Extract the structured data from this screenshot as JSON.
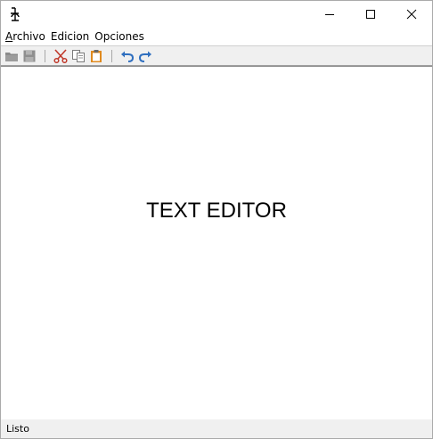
{
  "window": {
    "icon": "curly-glyph-icon",
    "controls": [
      "minimize-icon",
      "maximize-icon",
      "close-icon"
    ]
  },
  "menubar": {
    "items": [
      {
        "label_accel": "A",
        "label_rest": "rchivo"
      },
      {
        "label_accel": "",
        "label_rest": "Edicion"
      },
      {
        "label_accel": "",
        "label_rest": "Opciones"
      }
    ]
  },
  "toolbar": {
    "buttons": [
      "open-folder-icon",
      "save-disk-icon",
      "cut-scissors-icon",
      "copy-icon",
      "paste-clipboard-icon",
      "undo-icon",
      "redo-icon"
    ]
  },
  "editor": {
    "text": "TEXT EDITOR"
  },
  "statusbar": {
    "text": "Listo"
  },
  "colors": {
    "toolbar_bg": "#f0f0f0",
    "cut_red": "#c0392b",
    "paste_orange": "#e08a1e",
    "undo_blue": "#2f6fbf",
    "disabled_gray": "#8a8a8a"
  }
}
